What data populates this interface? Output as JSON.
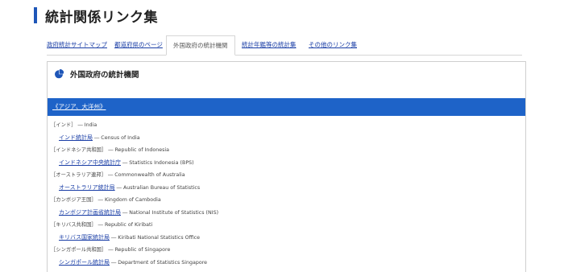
{
  "page": {
    "title": "統計関係リンク集"
  },
  "tabs": [
    {
      "label": "政府統計サイトマップ",
      "active": false
    },
    {
      "label": "都道府県のページ",
      "active": false
    },
    {
      "label": "外国政府の統計機関",
      "active": true
    },
    {
      "label": "統計年鑑等の統計集",
      "active": false
    },
    {
      "label": "その他のリンク集",
      "active": false
    }
  ],
  "panel": {
    "title": "外国政府の統計機関",
    "icon": "pie-chart-icon",
    "region": "《アジア、大洋州》"
  },
  "entries": [
    {
      "country": "［インド］ ― India",
      "agency": "インド統計局",
      "english": " ― Census of India"
    },
    {
      "country": "［インドネシア共和国］ ― Republic of Indonesia",
      "agency": "インドネシア中央統計庁",
      "english": " ― Statistics Indonesia (BPS)"
    },
    {
      "country": "［オーストラリア連邦］ ― Commonwealth of Australia",
      "agency": "オーストラリア統計局",
      "english": " ― Australian Bureau of Statistics"
    },
    {
      "country": "［カンボジア王国］ ― Kingdom of Cambodia",
      "agency": "カンボジア計画省統計局",
      "english": " ― National Institute of Statistics (NIS)"
    },
    {
      "country": "［キリバス共和国］ ― Republic of Kiribati",
      "agency": "キリバス国家統計局",
      "english": " ― Kiribati National Statistics Office"
    },
    {
      "country": "［シンガポール共和国］ ― Republic of Singapore",
      "agency": "シンガポール統計局",
      "english": " ― Department of Statistics Singapore"
    }
  ],
  "colors": {
    "accent": "#1e56b8",
    "region_bar": "#1e63c8",
    "link": "#1a3ea6"
  }
}
